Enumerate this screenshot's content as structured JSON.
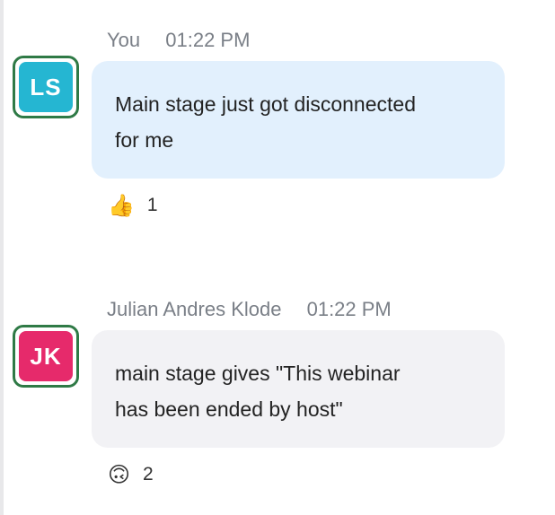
{
  "messages": [
    {
      "sender": "You",
      "time": "01:22 PM",
      "avatar_initials": "LS",
      "avatar_color": "#25b6d2",
      "bubble_color": "#e2f0fd",
      "text_lines": [
        "Main stage just got disconnected",
        "for me"
      ],
      "reaction": {
        "emoji": "👍",
        "icon": "thumbs-up-icon",
        "count": "1"
      }
    },
    {
      "sender": "Julian Andres Klode",
      "time": "01:22 PM",
      "avatar_initials": "JK",
      "avatar_color": "#e62a6b",
      "bubble_color": "#f2f2f5",
      "text_lines": [
        "main stage gives \"This webinar",
        "has been ended by host\""
      ],
      "reaction": {
        "emoji": "🙃",
        "icon": "upside-down-face-icon",
        "count": "2"
      }
    }
  ],
  "colors": {
    "avatar_ring": "#2f7a46",
    "meta_text": "#7a7f87",
    "message_text": "#232323"
  }
}
